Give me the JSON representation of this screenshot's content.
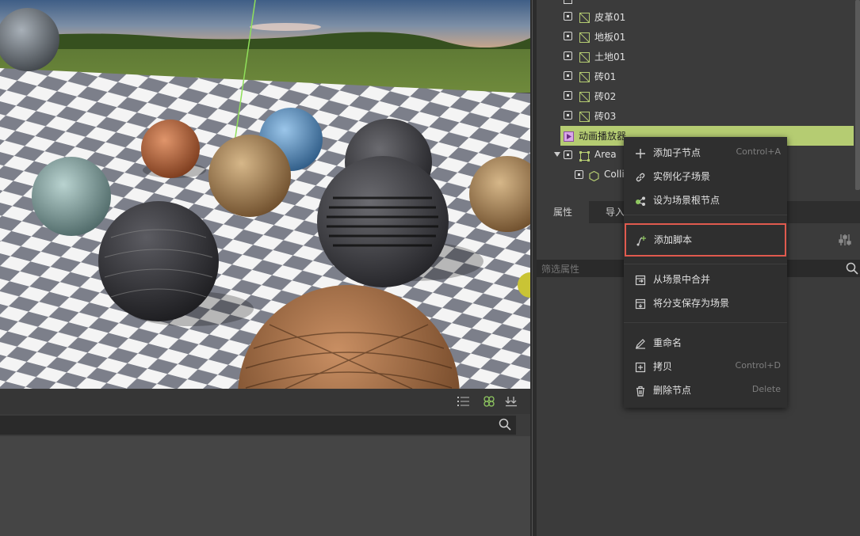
{
  "scene_tree": {
    "items": [
      {
        "label": "皮革01",
        "icon": "material-icon",
        "indent": 0
      },
      {
        "label": "地板01",
        "icon": "material-icon",
        "indent": 0
      },
      {
        "label": "土地01",
        "icon": "material-icon",
        "indent": 0
      },
      {
        "label": "砖01",
        "icon": "material-icon",
        "indent": 0
      },
      {
        "label": "砖02",
        "icon": "material-icon",
        "indent": 0
      },
      {
        "label": "砖03",
        "icon": "material-icon",
        "indent": 0
      },
      {
        "label": "动画播放器",
        "icon": "animation-player-icon",
        "selected": true
      },
      {
        "label": "Area",
        "icon": "area-icon",
        "expanded": true
      },
      {
        "label": "Colli",
        "icon": "collision-shape-icon"
      }
    ]
  },
  "inspector": {
    "tabs": [
      {
        "label": "属性",
        "active": true
      },
      {
        "label": "导入",
        "active": false
      }
    ],
    "filter_placeholder": "筛选属性"
  },
  "context_menu": {
    "items": [
      {
        "label": "添加子节点",
        "shortcut": "Control+A",
        "icon": "plus-icon"
      },
      {
        "label": "实例化子场景",
        "shortcut": "",
        "icon": "link-icon"
      },
      {
        "label": "设为场景根节点",
        "shortcut": "",
        "icon": "make-root-icon"
      },
      {
        "label": "添加脚本",
        "shortcut": "",
        "icon": "script-add-icon",
        "highlighted": true
      },
      {
        "label": "从场景中合并",
        "shortcut": "",
        "icon": "merge-scene-icon"
      },
      {
        "label": "将分支保存为场景",
        "shortcut": "",
        "icon": "save-branch-icon"
      },
      {
        "label": "重命名",
        "shortcut": "",
        "icon": "rename-icon"
      },
      {
        "label": "拷贝",
        "shortcut": "Control+D",
        "icon": "duplicate-icon"
      },
      {
        "label": "删除节点",
        "shortcut": "Delete",
        "icon": "trash-icon"
      }
    ],
    "highlight_color": "#e05a4e"
  },
  "colors": {
    "selected_row": "#b5cc72",
    "panel_bg": "#3b3b3b",
    "field_bg": "#2a2a2a"
  }
}
